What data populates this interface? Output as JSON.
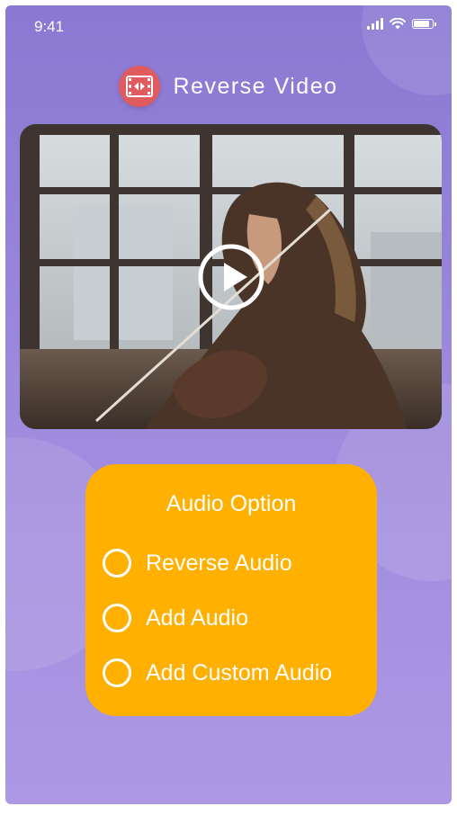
{
  "status_bar": {
    "time": "9:41",
    "icons": [
      "signal-icon",
      "wifi-icon",
      "battery-icon"
    ]
  },
  "header": {
    "logo_icon": "film-reverse-icon",
    "title": "Reverse Video"
  },
  "video": {
    "play_icon": "play-icon"
  },
  "audio_options": {
    "title": "Audio Option",
    "options": [
      {
        "label": "Reverse Audio",
        "selected": false
      },
      {
        "label": "Add Audio",
        "selected": false
      },
      {
        "label": "Add Custom Audio",
        "selected": false
      }
    ]
  },
  "colors": {
    "background_top": "#8a78d2",
    "background_bottom": "#ad98e4",
    "card": "#ffb000",
    "logo": "#e05a5e",
    "text": "#ffffff"
  }
}
